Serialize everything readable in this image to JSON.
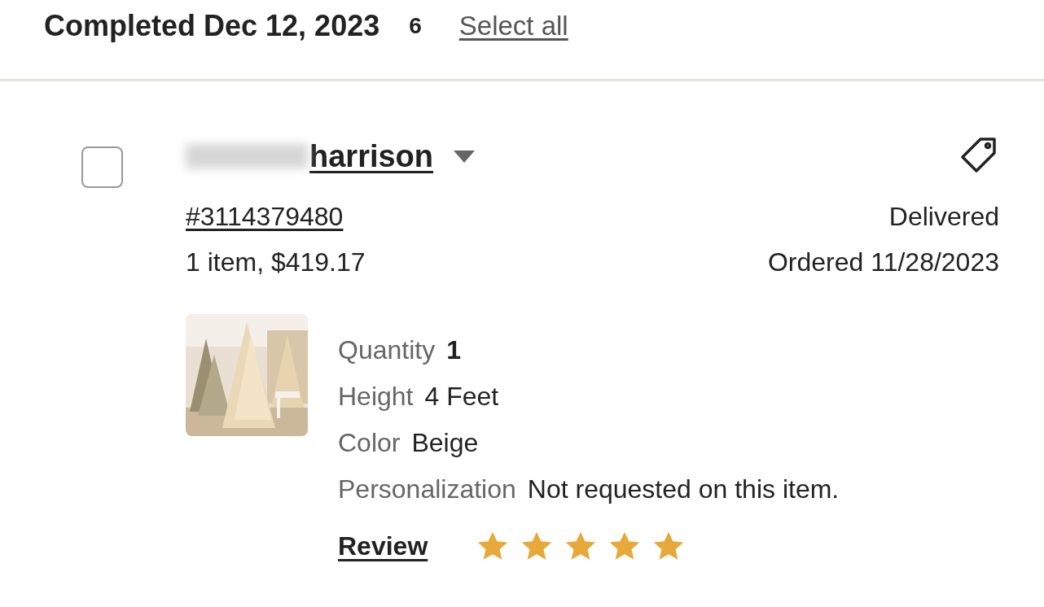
{
  "group": {
    "title": "Completed Dec 12, 2023",
    "count": "6",
    "select_all": "Select all"
  },
  "order": {
    "selected": false,
    "buyer": "harrison",
    "buyer_redacted": true,
    "number": "#3114379480",
    "summary": "1 item,  $419.17",
    "status": "Delivered",
    "ordered": "Ordered 11/28/2023",
    "details": [
      {
        "label": "Quantity",
        "value": "1",
        "bold": true
      },
      {
        "label": "Height",
        "value": "4 Feet",
        "bold": false
      },
      {
        "label": "Color",
        "value": "Beige",
        "bold": false
      },
      {
        "label": "Personalization",
        "value": "Not requested on this item.",
        "bold": false
      }
    ],
    "review": {
      "label": "Review",
      "stars": 5
    }
  }
}
